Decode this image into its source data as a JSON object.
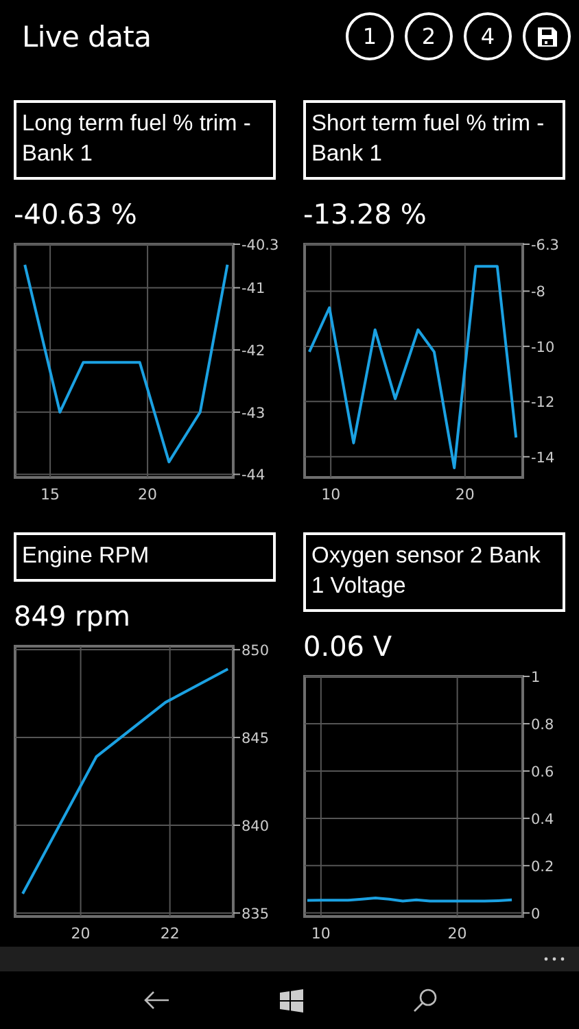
{
  "header": {
    "title": "Live data",
    "buttons": [
      {
        "label": "1"
      },
      {
        "label": "2"
      },
      {
        "label": "4"
      }
    ]
  },
  "tiles": [
    {
      "title": "Long term fuel % trim - Bank 1",
      "value": "-40.63 %",
      "chart_data": {
        "type": "line",
        "x": [
          13.7,
          15.5,
          16.7,
          19.6,
          21.1,
          22.7,
          24.1
        ],
        "grid": true,
        "series": [
          {
            "color": "#1ba1e2",
            "values": [
              -40.63,
              -43.0,
              -42.2,
              -42.2,
              -43.8,
              -43.0,
              -40.63
            ]
          }
        ],
        "xlim": [
          13.2,
          24.4
        ],
        "ylim": [
          -44.05,
          -40.3
        ],
        "xticks": [
          15,
          20
        ],
        "yticks": [
          -40.3,
          -41,
          -42,
          -43,
          -44
        ]
      }
    },
    {
      "title": "Short term fuel % trim - Bank 1",
      "value": "-13.28 %",
      "chart_data": {
        "type": "line",
        "x": [
          8.4,
          9.9,
          11.7,
          13.3,
          14.8,
          16.5,
          17.7,
          19.2,
          20.8,
          22.4,
          23.8
        ],
        "grid": true,
        "series": [
          {
            "color": "#1ba1e2",
            "values": [
              -10.2,
              -8.6,
              -13.5,
              -9.4,
              -11.9,
              -9.4,
              -10.2,
              -14.4,
              -7.1,
              -7.1,
              -13.3
            ]
          }
        ],
        "xlim": [
          8.05,
          24.3
        ],
        "ylim": [
          -14.75,
          -6.3
        ],
        "xticks": [
          10,
          20
        ],
        "yticks": [
          -6.3,
          -8,
          -10,
          -12,
          -14
        ]
      }
    },
    {
      "title": "Engine RPM",
      "value": "849 rpm",
      "chart_data": {
        "type": "line",
        "x": [
          18.7,
          20.35,
          21.9,
          23.3
        ],
        "grid": true,
        "series": [
          {
            "color": "#1ba1e2",
            "values": [
              836.1,
              843.9,
              847,
              848.9
            ]
          }
        ],
        "xlim": [
          18.53,
          23.42
        ],
        "ylim": [
          834.8,
          850.2
        ],
        "xticks": [
          20,
          22
        ],
        "yticks": [
          835,
          840,
          845,
          850
        ]
      }
    },
    {
      "title": "Oxygen sensor 2 Bank 1 Voltage",
      "value": "0.06 V",
      "chart_data": {
        "type": "line",
        "x": [
          9,
          10,
          11,
          12,
          13,
          14,
          15,
          16,
          17,
          18,
          19,
          20,
          21,
          22,
          23,
          24
        ],
        "grid": true,
        "series": [
          {
            "color": "#1ba1e2",
            "values": [
              0.053,
              0.054,
              0.054,
              0.054,
              0.058,
              0.063,
              0.058,
              0.05,
              0.055,
              0.05,
              0.05,
              0.05,
              0.05,
              0.05,
              0.052,
              0.055
            ]
          }
        ],
        "xlim": [
          8.8,
          24.8
        ],
        "ylim": [
          -0.015,
          1
        ],
        "xticks": [
          10,
          20
        ],
        "yticks": [
          0,
          0.2,
          0.4,
          0.6,
          0.8,
          1
        ]
      }
    }
  ]
}
